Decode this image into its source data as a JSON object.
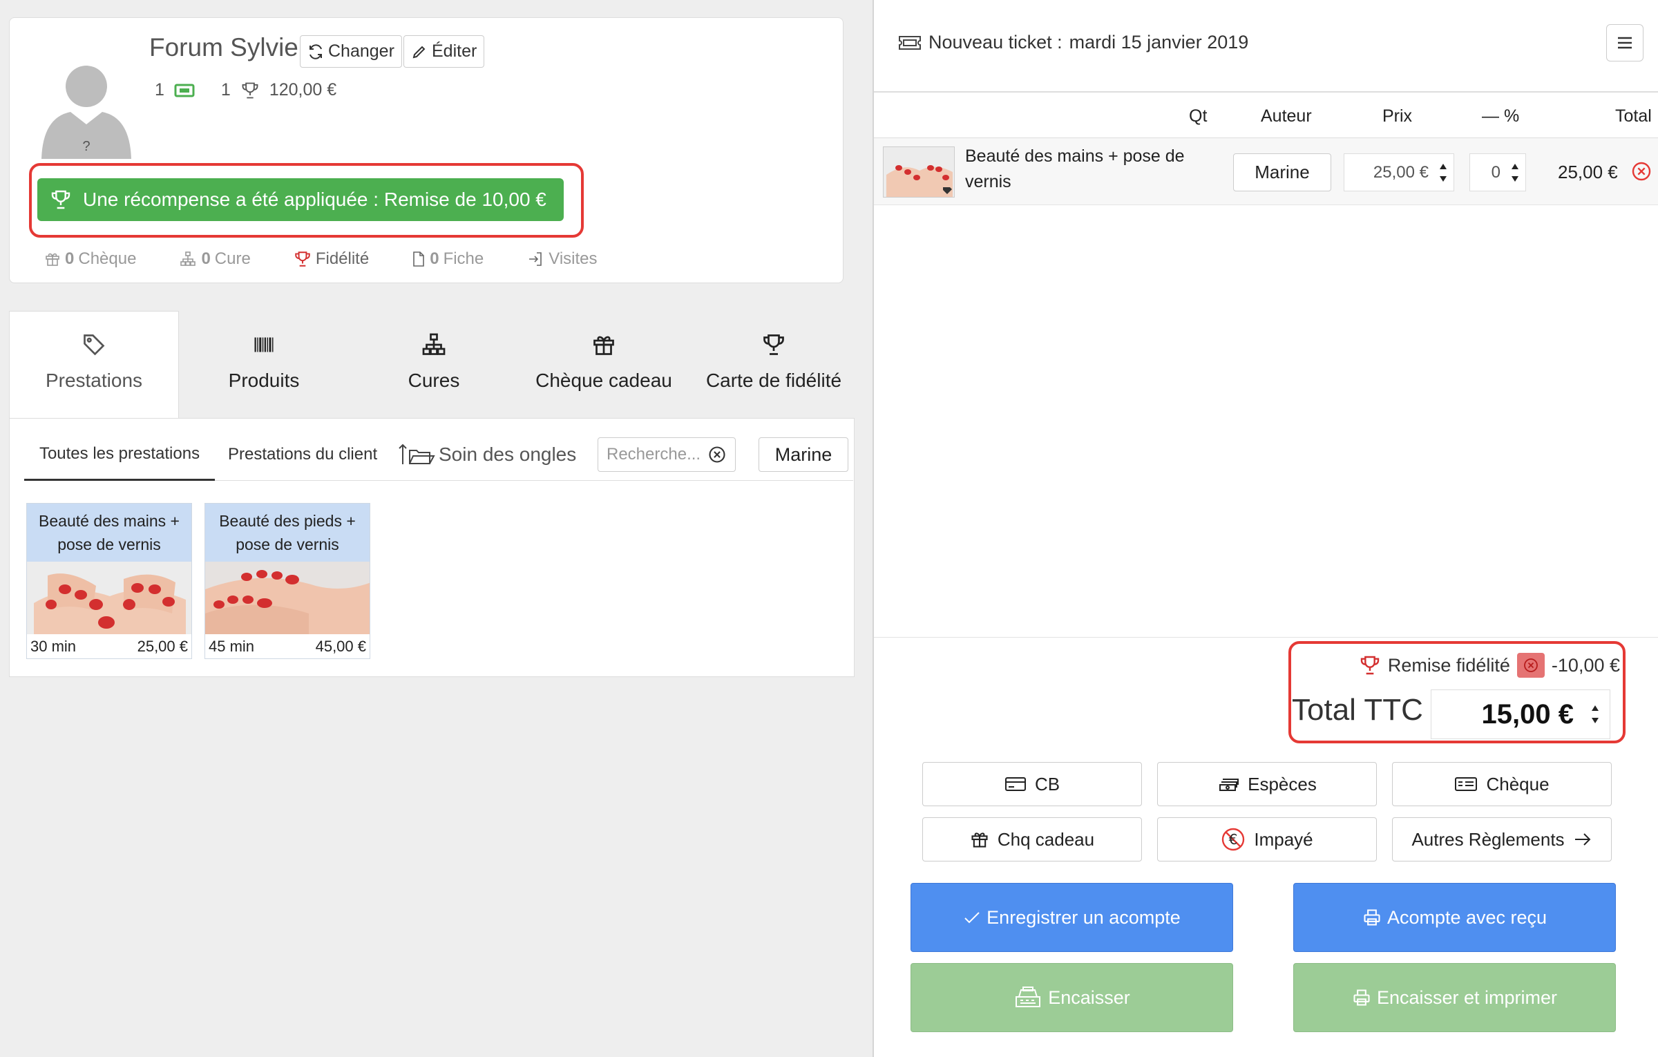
{
  "client": {
    "name": "Forum Sylvie",
    "avatar_badge": "?",
    "change_label": "Changer",
    "edit_label": "Éditer",
    "tickets_count": "1",
    "rewards_count": "1",
    "amount": "120,00 €"
  },
  "reward_banner": {
    "text": "Une récompense a été appliquée : Remise de  10,00 €"
  },
  "client_tabs": {
    "cheque_count": "0",
    "cheque_label": "Chèque",
    "cure_count": "0",
    "cure_label": "Cure",
    "fidelite_label": "Fidélité",
    "fiche_count": "0",
    "fiche_label": "Fiche",
    "visites_label": "Visites"
  },
  "catalog_tabs": [
    {
      "label": "Prestations",
      "icon": "tag-icon"
    },
    {
      "label": "Produits",
      "icon": "barcode-icon"
    },
    {
      "label": "Cures",
      "icon": "sitemap-icon"
    },
    {
      "label": "Chèque cadeau",
      "icon": "gift-icon"
    },
    {
      "label": "Carte de fidélité",
      "icon": "trophy-icon"
    }
  ],
  "subtabs": {
    "all": "Toutes les prestations",
    "client": "Prestations du client",
    "folder": "Soin des ongles",
    "search_placeholder": "Recherche...",
    "staff": "Marine"
  },
  "services": [
    {
      "title": "Beauté des mains + pose de vernis",
      "duration": "30 min",
      "price": "25,00 €"
    },
    {
      "title": "Beauté des pieds + pose de vernis",
      "duration": "45 min",
      "price": "45,00 €"
    }
  ],
  "ticket": {
    "title_prefix": "Nouveau ticket :",
    "date": "mardi 15 janvier 2019",
    "columns": {
      "qt": "Qt",
      "auteur": "Auteur",
      "prix": "Prix",
      "remise": "— %",
      "total": "Total"
    },
    "lines": [
      {
        "name": "Beauté des mains + pose de vernis",
        "author": "Marine",
        "price": "25,00 €",
        "discount": "0",
        "total": "25,00 €"
      }
    ],
    "remise_label": "Remise fidélité",
    "remise_value": "-10,00 €",
    "total_label": "Total TTC",
    "total_value": "15,00 €"
  },
  "payments": {
    "cb": "CB",
    "especes": "Espèces",
    "cheque": "Chèque",
    "chq_cadeau": "Chq cadeau",
    "impaye": "Impayé",
    "autres": "Autres Règlements"
  },
  "actions": {
    "acompte": "Enregistrer un acompte",
    "acompte_recu": "Acompte avec reçu",
    "encaisser": "Encaisser",
    "encaisser_imprimer": "Encaisser et imprimer"
  },
  "colors": {
    "green": "#4caf50",
    "red_highlight": "#e53935",
    "blue_button": "#4f8ff0",
    "green_button_disabled": "#9ccc96"
  }
}
